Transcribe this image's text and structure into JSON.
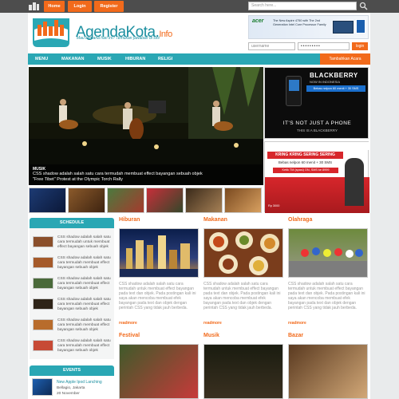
{
  "topbar": {
    "home_label": "Home",
    "login_label": "Login",
    "register_label": "Register",
    "search_placeholder": "Search here..."
  },
  "header": {
    "brand": "AgendaKota.",
    "brand_suffix": "Info",
    "tagline": "Mau kemana hari ini? Temukan jawaban di sini",
    "ad_text": "The New Aspire 4750 with The 2nd Generation Intel Core Processor Family",
    "username_placeholder": "username",
    "password_value": "•••••••••",
    "login_label": "login"
  },
  "nav": {
    "items": [
      "MENU",
      "MAKANAN",
      "MUSIK",
      "HIBURAN",
      "RELIGI"
    ],
    "cta_label": "Tambahkan Acara"
  },
  "slider": {
    "category": "MUSIK",
    "caption_line1": "CSS shadow adalah salah satu cara termudah membuat effect bayangan sebuah objek",
    "caption_line2": "\"Free Tibet\" Protest at the Olympic Torch Rally"
  },
  "ads": {
    "ad1_brand": "BLACKBERRY",
    "ad1_sub": "NOW IN INDONESIA",
    "ad1_promo": "Bebas nelpon 60 menit + 30 SMS",
    "ad1_slogan1": "IT'S NOT JUST A PHONE",
    "ad1_slogan2": "THIS IS A BLACKBERRY",
    "ad2_title": "KRING KRING SERING SERING",
    "ad2_sub": "Bebas nelpon 60 menit + 30 SMS",
    "ad2_cta": "Ketik TM (spasi) ON, SMS ke 8999",
    "ad2_price": "Rp 3000"
  },
  "schedule": {
    "title": "SCHEDULE",
    "items": [
      "CSS shadow adalah salah satu cara termudah untuk membuat effect bayangan sebuah objek",
      "CSS shadow adalah salah satu cara termudah membuat effect bayangan sebuah objek",
      "CSS shadow adalah salah satu cara termudah membuat effect bayangan sebuah objek",
      "CSS shadow adalah salah satu cara termudah membuat effect bayangan sebuah objek",
      "CSS shadow adalah salah satu cara termudah membuat effect bayangan sebuah objek",
      "CSS shadow adalah salah satu cara termudah membuat effect bayangan sebuah objek"
    ]
  },
  "events": {
    "title": "EVENTS",
    "item_title": "New Apple Ipod Lanching",
    "item_place": "Bellagio, Jakarta",
    "item_date": "20 November"
  },
  "columns": [
    {
      "title": "Hiburan",
      "text": "CSS shadow adalah salah satu cara termudah untuk membuat effect bayangan pada text dan objek. Pada postingan kali ini saya akan mencoba membuat efek bayangan pada text dan objek dengan perintah CSS yang tidak jauh berbeda.",
      "readmore": "readmore"
    },
    {
      "title": "Makanan",
      "text": "CSS shadow adalah salah satu cara termudah untuk membuat effect bayangan pada text dan objek. Pada postingan kali ini saya akan mencoba membuat efek bayangan pada text dan objek dengan perintah CSS yang tidak jauh berbeda.",
      "readmore": "readmore"
    },
    {
      "title": "Olahraga",
      "text": "CSS shadow adalah salah satu cara termudah untuk membuat effect bayangan pada text dan objek. Pada postingan kali ini saya akan mencoba membuat efek bayangan pada text dan objek dengan perintah CSS yang tidak jauh berbeda.",
      "readmore": "readmore"
    },
    {
      "title": "Festival"
    },
    {
      "title": "Musik"
    },
    {
      "title": "Bazar"
    }
  ],
  "colors": {
    "accent": "#f26a1b",
    "teal": "#2aa7b4",
    "topbar": "#4d4d4d"
  }
}
